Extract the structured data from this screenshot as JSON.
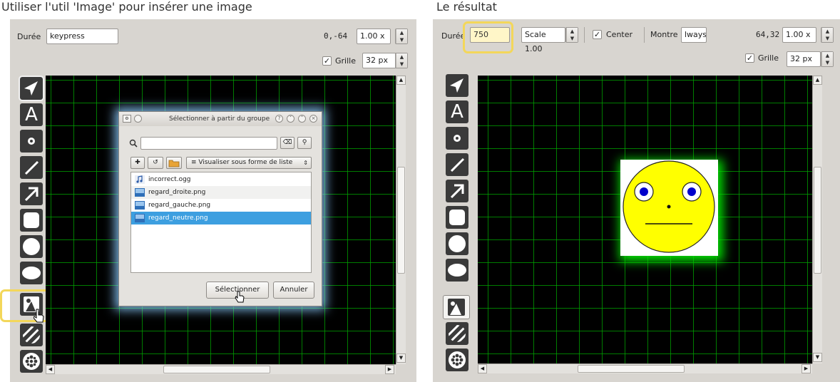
{
  "left": {
    "caption": "Utiliser l'util 'Image' pour insérer une image",
    "toolbar": {
      "duration_label": "Durée",
      "duration_value": "keypress",
      "coords": "0,-64",
      "zoom_value": "1.00 x",
      "grid_label": "Grille",
      "grid_checked": true,
      "grid_size": "32 px"
    },
    "dialog": {
      "title": "Sélectionner à partir du groupe",
      "search_placeholder": "",
      "view_mode": "Visualiser sous forme de liste",
      "files": [
        "incorrect.ogg",
        "regard_droite.png",
        "regard_gauche.png",
        "regard_neutre.png"
      ],
      "selected_file": "regard_neutre.png",
      "select_button": "Sélectionner",
      "cancel_button": "Annuler"
    }
  },
  "right": {
    "caption": "Le résultat",
    "toolbar": {
      "duration_label": "Durée",
      "duration_value": "750",
      "scale_value": "Scale 1.00",
      "center_label": "Center",
      "center_checked": true,
      "show_label": "Montre",
      "show_value": "lways",
      "coords": "64,32",
      "zoom_value": "1.00 x",
      "grid_label": "Grille",
      "grid_checked": true,
      "grid_size": "32 px"
    },
    "canvas_object": "face-image"
  },
  "tools": [
    "select-arrow-tool",
    "text-tool",
    "point-tool",
    "line-tool",
    "arrow-tool",
    "rounded-rect-tool",
    "circle-tool",
    "ellipse-tool",
    "image-tool",
    "hatch-tool",
    "flower-tool"
  ],
  "colors": {
    "panel_bg": "#d8d5d0",
    "canvas_bg": "#000000",
    "grid": "#00a500",
    "highlight": "#f3d75a",
    "selection": "#3d9fe0",
    "face_yellow": "#ffff00",
    "face_glow": "#00ff00",
    "eye_blue": "#0000cc"
  }
}
